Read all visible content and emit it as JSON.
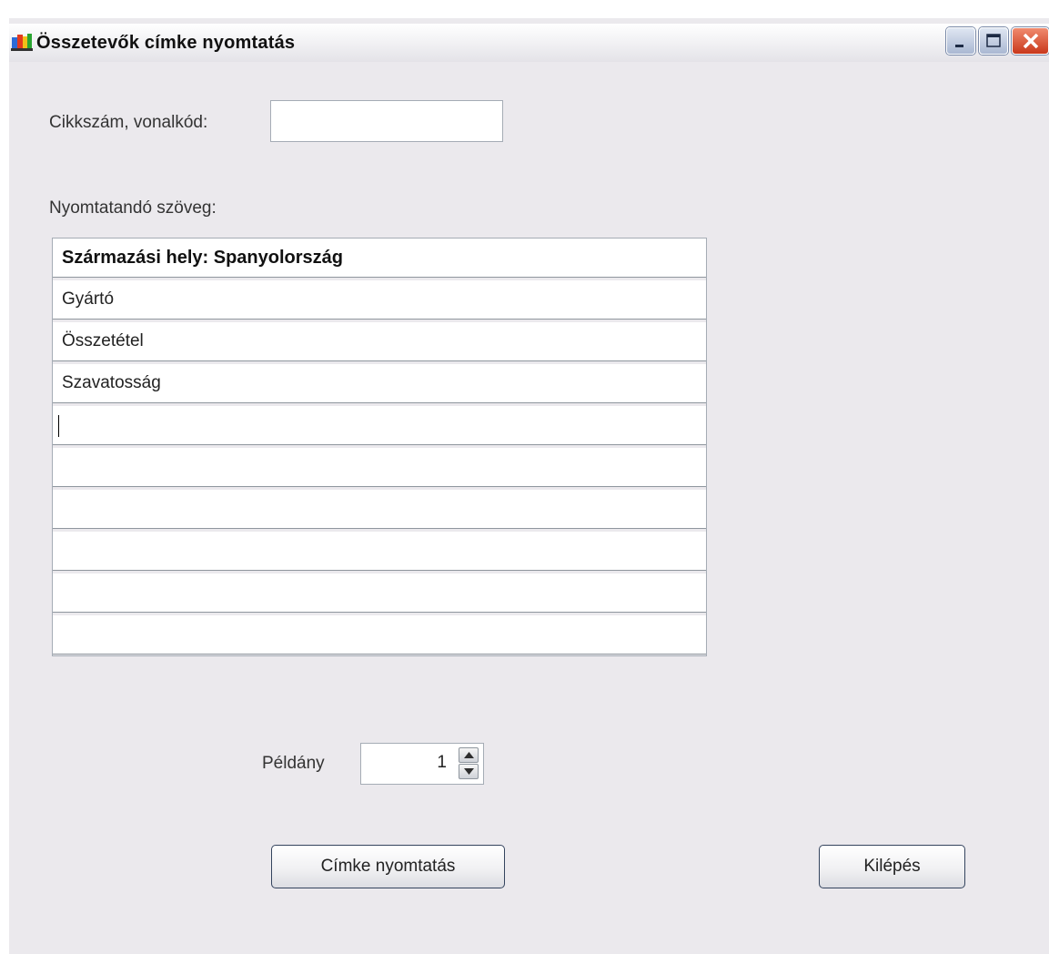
{
  "window": {
    "title": "Összetevők címke nyomtatás"
  },
  "form": {
    "sku_label": "Cikkszám, vonalkód:",
    "sku_value": "",
    "print_text_label": "Nyomtatandó szöveg:",
    "rows": [
      "Származási hely: Spanyolország",
      "Gyártó",
      "Összetétel",
      "Szavatosság",
      "",
      "",
      "",
      "",
      "",
      ""
    ],
    "copies_label": "Példány",
    "copies_value": "1"
  },
  "buttons": {
    "print": "Címke nyomtatás",
    "exit": "Kilépés"
  },
  "colors": {
    "window_bg": "#ebe9ed",
    "close_button": "#c9381b"
  }
}
